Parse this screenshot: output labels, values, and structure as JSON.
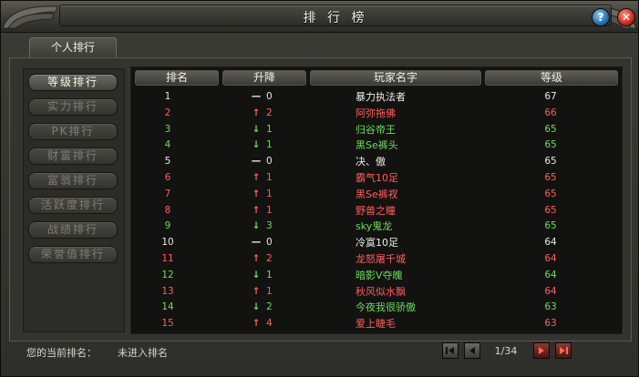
{
  "window": {
    "title": "排 行 榜"
  },
  "tabs": [
    {
      "label": "个人排行"
    }
  ],
  "categories": [
    {
      "label": "等级排行",
      "active": true
    },
    {
      "label": "实力排行",
      "active": false
    },
    {
      "label": "PK排行",
      "active": false
    },
    {
      "label": "财富排行",
      "active": false
    },
    {
      "label": "富翁排行",
      "active": false
    },
    {
      "label": "活跃度排行",
      "active": false
    },
    {
      "label": "战绩排行",
      "active": false
    },
    {
      "label": "荣誉值排行",
      "active": false
    }
  ],
  "table": {
    "columns": [
      "排名",
      "升降",
      "玩家名字",
      "等级"
    ],
    "rows": [
      {
        "rank": "1",
        "trend": "same",
        "delta": "0",
        "name": "暴力执法者",
        "level": "67"
      },
      {
        "rank": "2",
        "trend": "up",
        "delta": "2",
        "name": "阿弥拖佛",
        "level": "66"
      },
      {
        "rank": "3",
        "trend": "down",
        "delta": "1",
        "name": "归谷帝王",
        "level": "65"
      },
      {
        "rank": "4",
        "trend": "down",
        "delta": "1",
        "name": "黑Se裤头",
        "level": "65"
      },
      {
        "rank": "5",
        "trend": "same",
        "delta": "0",
        "name": "决、傲",
        "level": "65"
      },
      {
        "rank": "6",
        "trend": "up",
        "delta": "1",
        "name": "霸气10足",
        "level": "65"
      },
      {
        "rank": "7",
        "trend": "up",
        "delta": "1",
        "name": "黑Se裤衩",
        "level": "65"
      },
      {
        "rank": "8",
        "trend": "up",
        "delta": "1",
        "name": "野兽之瞳",
        "level": "65"
      },
      {
        "rank": "9",
        "trend": "down",
        "delta": "3",
        "name": "sky鬼龙",
        "level": "65"
      },
      {
        "rank": "10",
        "trend": "same",
        "delta": "0",
        "name": "冷寞10足",
        "level": "64"
      },
      {
        "rank": "11",
        "trend": "up",
        "delta": "2",
        "name": "龙怒屠千城",
        "level": "64"
      },
      {
        "rank": "12",
        "trend": "down",
        "delta": "1",
        "name": "暗影V夺魄",
        "level": "64"
      },
      {
        "rank": "13",
        "trend": "up",
        "delta": "1",
        "name": "秋风似水飘",
        "level": "64"
      },
      {
        "rank": "14",
        "trend": "down",
        "delta": "2",
        "name": "今夜我很骄傲",
        "level": "63"
      },
      {
        "rank": "15",
        "trend": "up",
        "delta": "4",
        "name": "爱上睫毛",
        "level": "63"
      }
    ]
  },
  "trend_glyphs": {
    "up": "↑",
    "down": "↓",
    "same": "—"
  },
  "colors": {
    "up": "#ff5e5e",
    "down": "#6cdc5e",
    "same": "#e8e8e0"
  },
  "footer": {
    "rank_label": "您的当前排名：",
    "rank_value": "未进入排名",
    "page_indicator": "1/34"
  }
}
